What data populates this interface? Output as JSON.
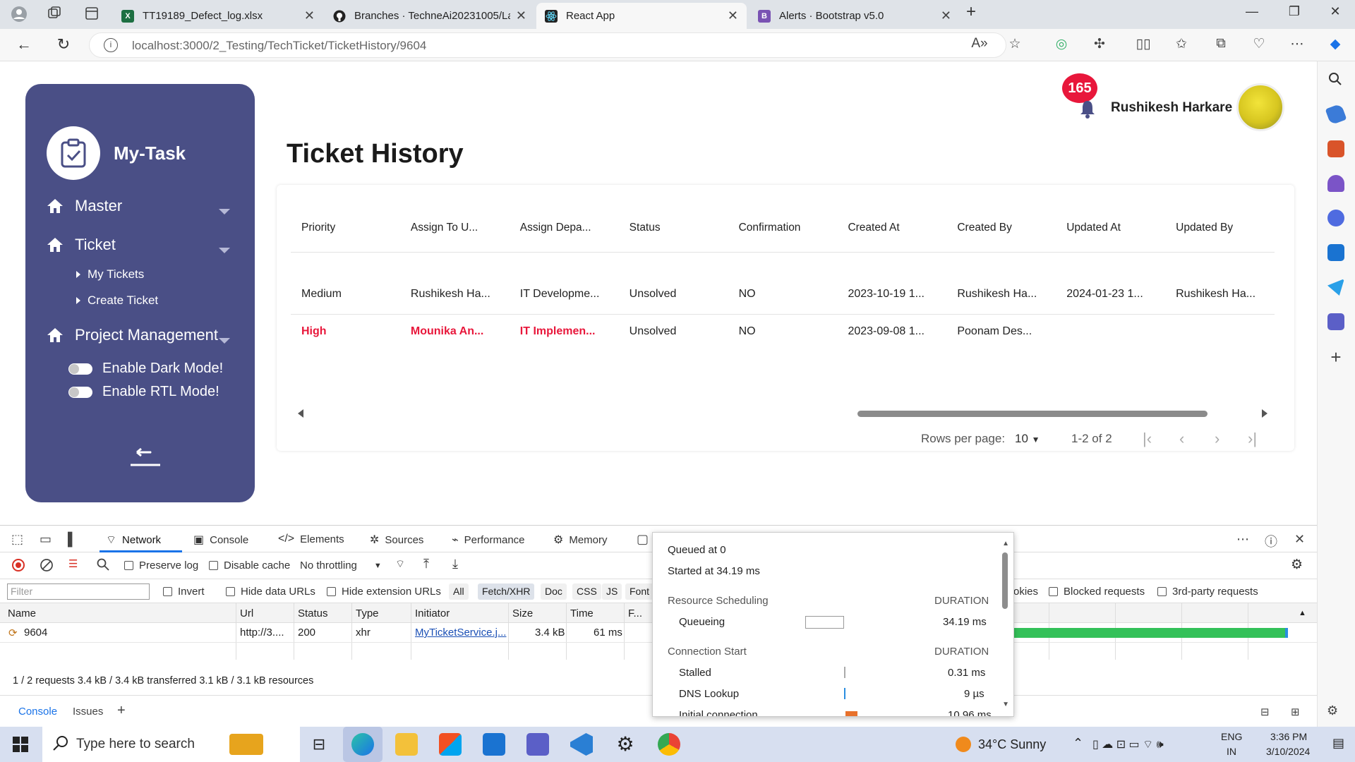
{
  "browser": {
    "tabs": [
      {
        "title": "TT19189_Defect_log.xlsx",
        "icon": "excel-icon",
        "color": "#1d6f42",
        "letter": "X"
      },
      {
        "title": "Branches · TechneAi20231005/La",
        "icon": "github-icon",
        "color": "#222222",
        "letter": ""
      },
      {
        "title": "React App",
        "icon": "react-icon",
        "color": "#222222",
        "letter": ""
      },
      {
        "title": "Alerts · Bootstrap v5.0",
        "icon": "bootstrap-icon",
        "color": "#7952b3",
        "letter": "B"
      }
    ],
    "url_host": "localhost",
    "url_path": ":3000/2_Testing/TechTicket/TicketHistory/9604"
  },
  "sidebar": {
    "logo_text": "My-Task",
    "items": [
      {
        "label": "Master"
      },
      {
        "label": "Ticket"
      },
      {
        "label": "Project Management"
      }
    ],
    "ticket_subitems": [
      "My Tickets",
      "Create Ticket"
    ],
    "toggles": [
      "Enable Dark Mode!",
      "Enable RTL Mode!"
    ],
    "bg_color": "#4a4f86"
  },
  "header": {
    "notification_count": "165",
    "user_name": "Rushikesh Harkare"
  },
  "page": {
    "title": "Ticket History"
  },
  "table": {
    "columns": [
      "Priority",
      "Assign To U...",
      "Assign Depa...",
      "Status",
      "Confirmation",
      "Created At",
      "Created By",
      "Updated At",
      "Updated By"
    ],
    "rows": [
      [
        "Medium",
        "Rushikesh Ha...",
        "IT Developme...",
        "Unsolved",
        "NO",
        "2023-10-19 1...",
        "Rushikesh Ha...",
        "2024-01-23 1...",
        "Rushikesh Ha..."
      ],
      [
        "High",
        "Mounika An...",
        "IT Implemen...",
        "Unsolved",
        "NO",
        "2023-09-08 1...",
        "Poonam Des...",
        "",
        ""
      ]
    ],
    "high_color": "#e8173b"
  },
  "pagination": {
    "rows_per_page_label": "Rows per page:",
    "rows_per_page_value": "10",
    "range": "1-2 of 2"
  },
  "devtools": {
    "tabs": [
      "Network",
      "Console",
      "Elements",
      "Sources",
      "Performance",
      "Memory"
    ],
    "preserve_log": "Preserve log",
    "disable_cache": "Disable cache",
    "throttling": "No throttling",
    "filter_placeholder": "Filter",
    "invert": "Invert",
    "hide_data_urls": "Hide data URLs",
    "hide_ext_urls": "Hide extension URLs",
    "type_chips": [
      "All",
      "Fetch/XHR",
      "Doc",
      "CSS",
      "JS",
      "Font"
    ],
    "cookies_partial": "okies",
    "blocked_requests": "Blocked requests",
    "third_party": "3rd-party requests",
    "columns": [
      "Name",
      "Url",
      "Status",
      "Type",
      "Initiator",
      "Size",
      "Time",
      "F..."
    ],
    "request": {
      "name": "9604",
      "url": "http://3....",
      "status": "200",
      "type": "xhr",
      "initiator": "MyTicketService.j...",
      "size": "3.4 kB",
      "time": "61 ms"
    },
    "summary": "1 / 2 requests  3.4 kB / 3.4 kB transferred  3.1 kB / 3.1 kB resources",
    "drawer_tabs": [
      "Console",
      "Issues"
    ],
    "timing": {
      "queued": "Queued at 0",
      "started": "Started at 34.19 ms",
      "resource_scheduling": "Resource Scheduling",
      "connection_start": "Connection Start",
      "duration": "DURATION",
      "queueing": {
        "label": "Queueing",
        "value": "34.19 ms"
      },
      "stalled": {
        "label": "Stalled",
        "value": "0.31 ms"
      },
      "dns": {
        "label": "DNS Lookup",
        "value": "9 µs"
      },
      "initial": {
        "label": "Initial connection",
        "value": "10.96 ms"
      }
    }
  },
  "taskbar": {
    "search_placeholder": "Type here to search",
    "weather": "34°C  Sunny",
    "lang_top": "ENG",
    "lang_bottom": "IN",
    "time": "3:36 PM",
    "date": "3/10/2024"
  }
}
